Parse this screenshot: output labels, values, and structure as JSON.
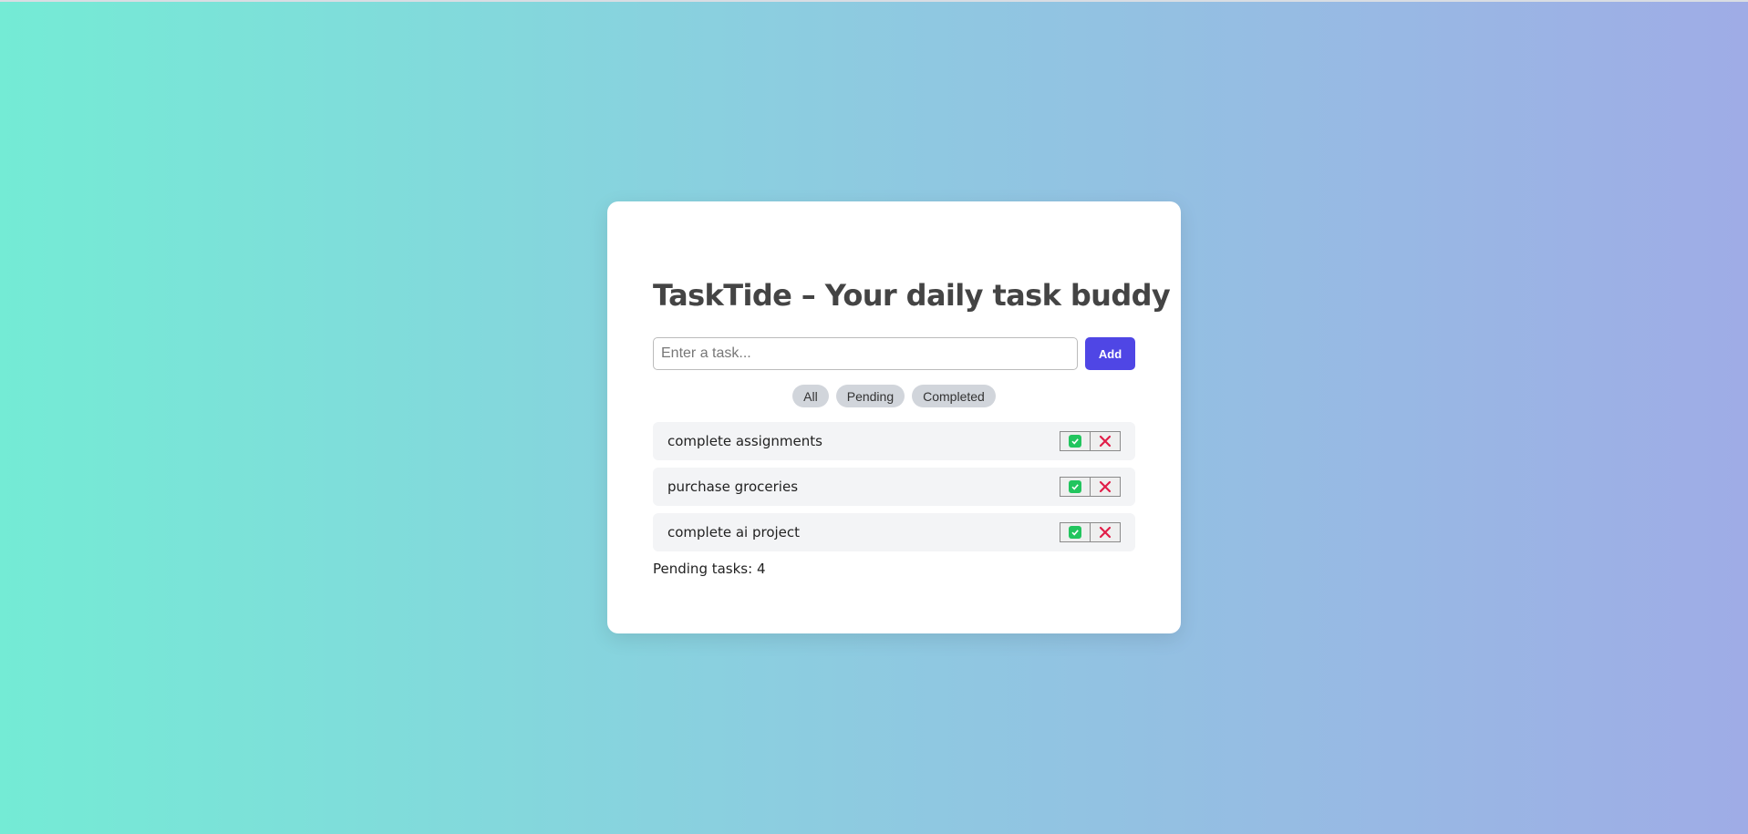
{
  "app": {
    "title": "TaskTide – Your daily task buddy"
  },
  "input": {
    "placeholder": "Enter a task...",
    "value": "",
    "add_label": "Add"
  },
  "filters": [
    {
      "label": "All"
    },
    {
      "label": "Pending"
    },
    {
      "label": "Completed"
    }
  ],
  "tasks": [
    {
      "text": "complete assignments",
      "complete_icon": "check-box-icon",
      "delete_icon": "close-icon"
    },
    {
      "text": "purchase groceries",
      "complete_icon": "check-box-icon",
      "delete_icon": "close-icon"
    },
    {
      "text": "complete ai project",
      "complete_icon": "check-box-icon",
      "delete_icon": "close-icon"
    }
  ],
  "footer": {
    "pending_label": "Pending tasks: 4"
  },
  "colors": {
    "accent": "#4f46e5",
    "check": "#22c55e",
    "delete": "#e11d48",
    "chip": "#d1d5db",
    "task_bg": "#f3f4f6"
  }
}
